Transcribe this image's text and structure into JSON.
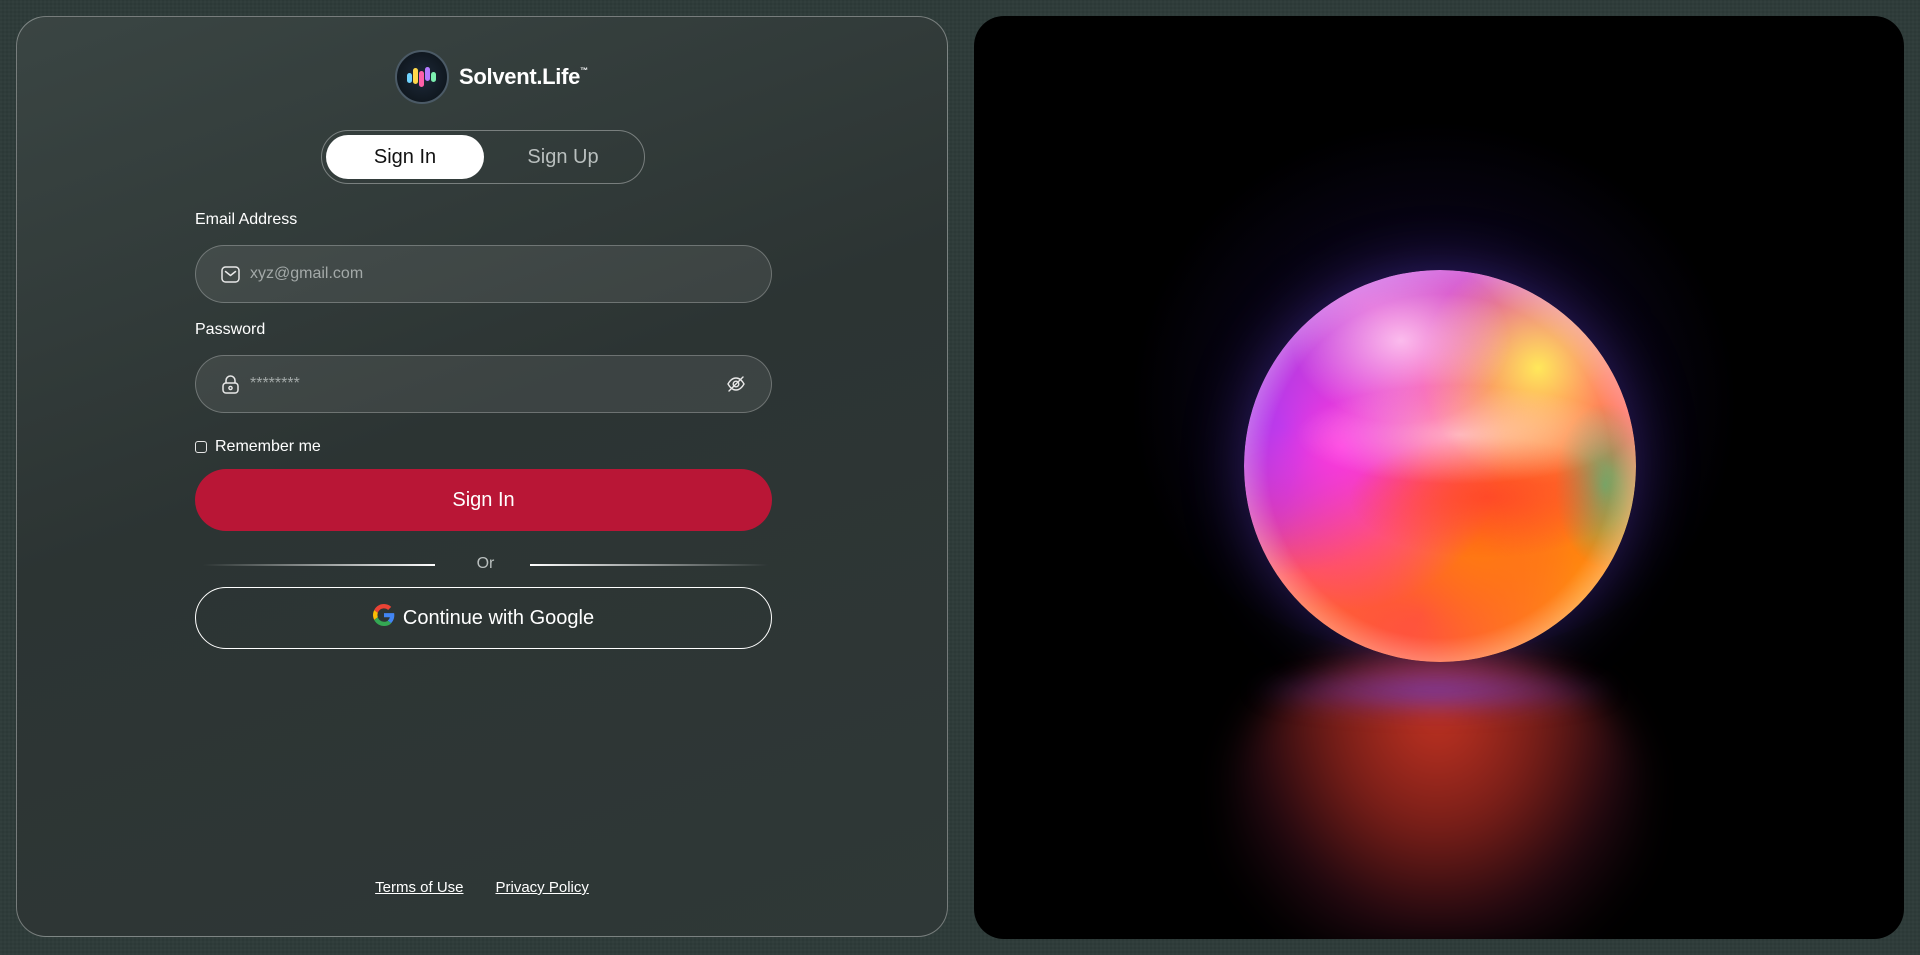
{
  "brand": {
    "name": "Solvent.Life",
    "trademark": "™",
    "logo_icon": "wave-logo-icon"
  },
  "tabs": [
    {
      "label": "Sign In",
      "active": true
    },
    {
      "label": "Sign Up",
      "active": false
    }
  ],
  "form": {
    "email_label": "Email Address",
    "email_placeholder": "xyz@gmail.com",
    "email_value": "",
    "email_icon": "mail-icon",
    "password_label": "Password",
    "password_placeholder": "********",
    "password_value": "",
    "password_icon": "lock-icon",
    "password_toggle_icon": "eye-off-icon",
    "remember_label": "Remember me",
    "remember_checked": false,
    "submit_label": "Sign In",
    "divider_text": "Or",
    "google_label": "Continue with Google",
    "google_icon": "google-icon"
  },
  "footer": {
    "terms_label": "Terms of Use",
    "privacy_label": "Privacy Policy"
  },
  "colors": {
    "accent": "#b91636",
    "panel": "#2f3837",
    "hero_background": "#000000"
  },
  "hero": {
    "image": "glowing-orb"
  }
}
